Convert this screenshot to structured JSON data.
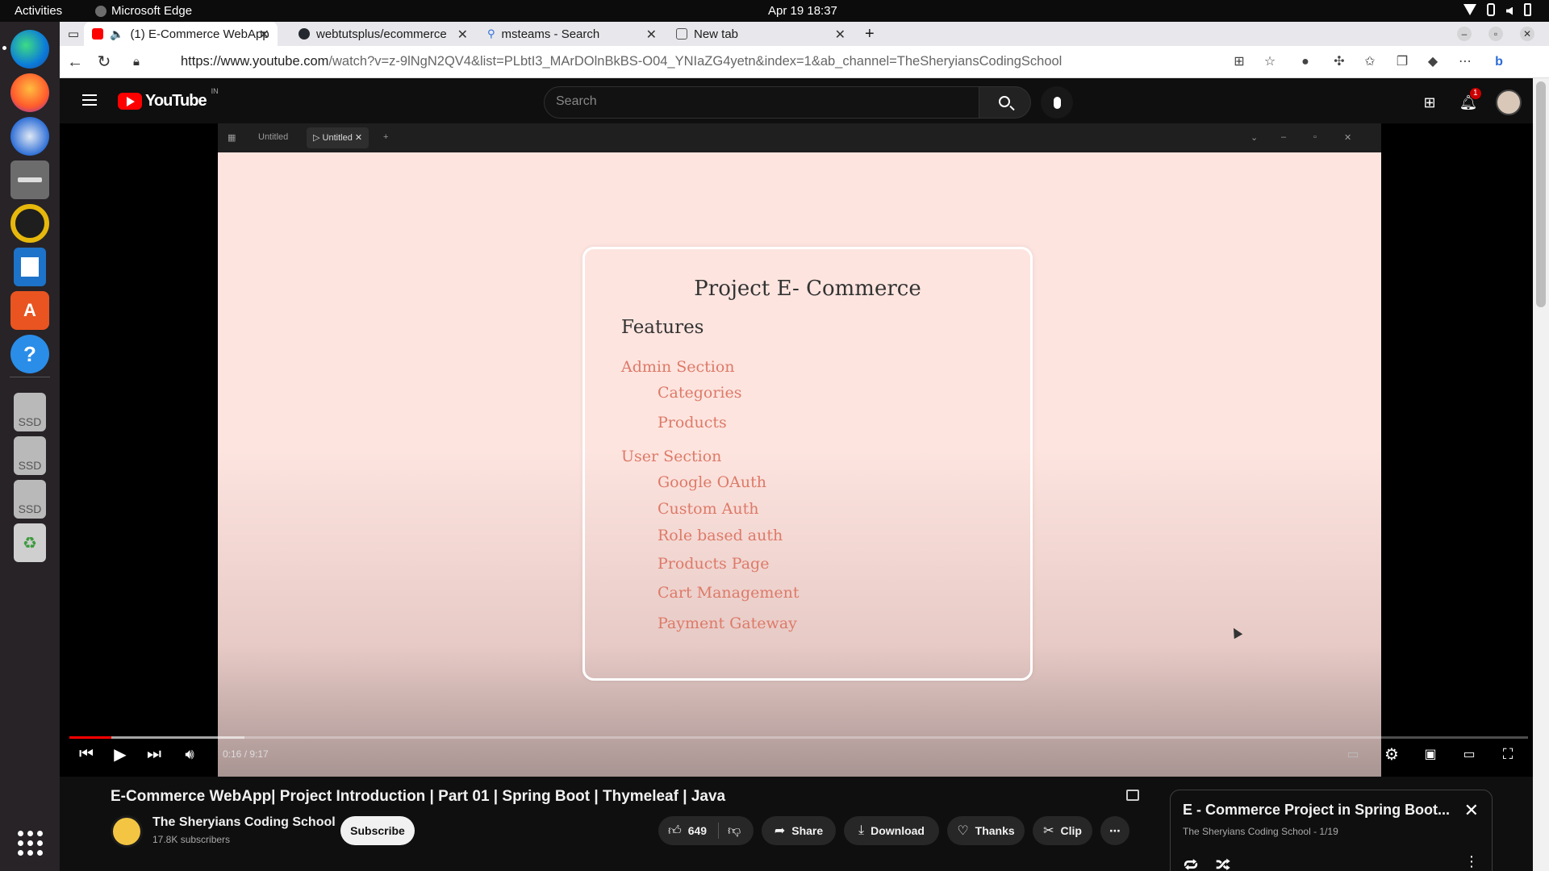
{
  "system": {
    "activities": "Activities",
    "app_name": "Microsoft Edge",
    "clock": "Apr 19  18:37"
  },
  "dock": {
    "items": [
      "edge-browser",
      "firefox",
      "thunderbird",
      "files",
      "rhythmbox",
      "libreoffice-writer",
      "app-center",
      "help"
    ],
    "drives": [
      "SSD",
      "SSD",
      "SSD"
    ],
    "trash": "trash",
    "show_apps": "show-apps"
  },
  "browser": {
    "tabs": [
      {
        "title": "(1) E-Commerce WebApp",
        "favicon_color": "#ff0000"
      },
      {
        "title": "webtutsplus/ecommerce",
        "favicon_color": "#24292f"
      },
      {
        "title": "msteams - Search",
        "favicon_color": "#2b6cd6"
      },
      {
        "title": "New tab",
        "favicon_color": "#777777"
      }
    ],
    "url_host": "https://www.youtube.com",
    "url_path": "/watch?v=z-9lNgN2QV4&list=PLbtI3_MArDOlnBkBS-O04_YNIaZG4yetn&index=1&ab_channel=TheSheryiansCodingSchool"
  },
  "youtube": {
    "logo": "YouTube",
    "country": "IN",
    "search_placeholder": "Search",
    "notification_count": "1",
    "video_title": "E-Commerce WebApp| Project Introduction | Part 01 | Spring Boot | Thymeleaf | Java",
    "channel_name": "The Sheryians Coding School",
    "subscribers": "17.8K subscribers",
    "subscribe_label": "Subscribe",
    "likes": "649",
    "share_label": "Share",
    "download_label": "Download",
    "thanks_label": "Thanks",
    "clip_label": "Clip",
    "time": "0:16 / 9:17",
    "progress_played_fraction": 0.029,
    "progress_buffered_fraction": 0.12,
    "playlist": {
      "title": "E - Commerce Project in Spring Boot...",
      "subtitle": "The Sheryians Coding School - 1/19"
    }
  },
  "slide": {
    "inner_tabs": [
      "Untitled",
      "Untitled"
    ],
    "title": "Project E- Commerce",
    "features": "Features",
    "admin_section": "Admin Section",
    "admin_items": [
      "Categories",
      "Products"
    ],
    "user_section": "User Section",
    "user_items": [
      "Google OAuth",
      "Custom Auth",
      "Role based auth",
      "Products Page",
      "Cart Management",
      "Payment Gateway"
    ]
  }
}
